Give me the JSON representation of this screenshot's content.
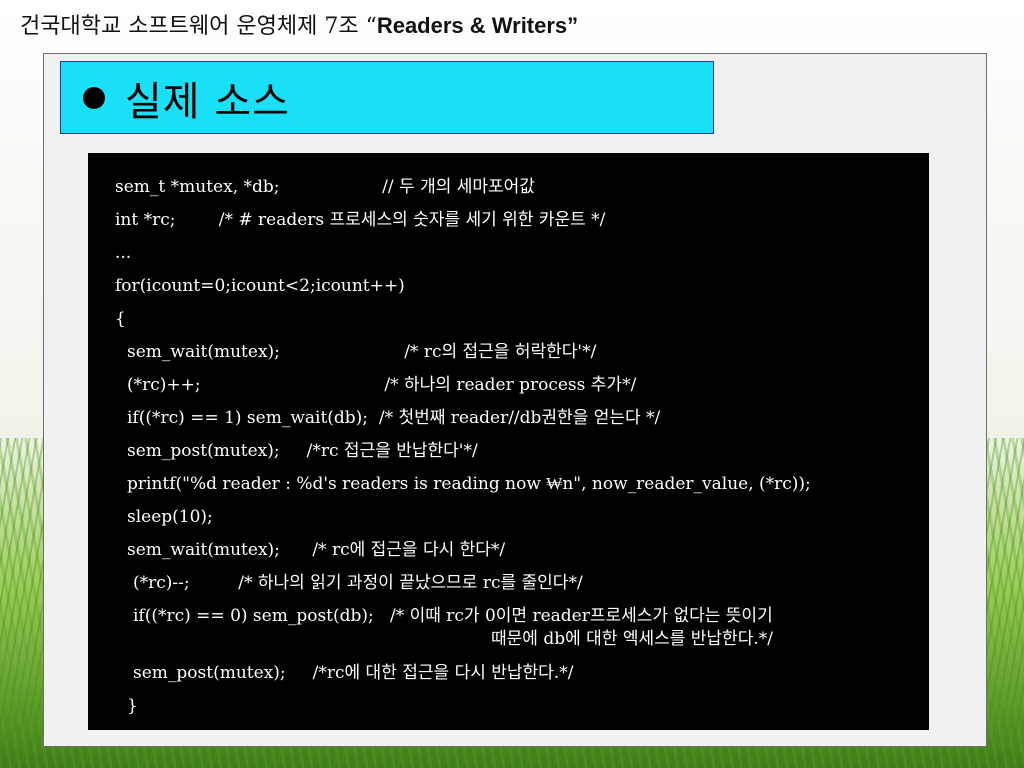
{
  "header": {
    "prefix": "건국대학교 소프트웨어 운영체제 7조 “",
    "title": "Readers & Writers”"
  },
  "slide": {
    "title": "실제 소스"
  },
  "code": {
    "lines": [
      "sem_t *mutex, *db;                   // 두 개의 세마포어값",
      "int *rc;        /* # readers 프로세스의 숫자를 세기 위한 카운트 */",
      "...",
      "for(icount=0;icount<2;icount++)",
      "{",
      "sem_wait(mutex);                       /* rc의 접근을 허락한다'*/",
      "(*rc)++;                                  /* 하나의 reader process 추가*/",
      "if((*rc) == 1) sem_wait(db);  /* 첫번째 reader//db권한을 얻는다 */",
      "sem_post(mutex);     /*rc 접근을 반납한다'*/",
      "printf(\"%d reader : %d's readers is reading now ₩n\", now_reader_value, (*rc));",
      "sleep(10);",
      "sem_wait(mutex);      /* rc에 접근을 다시 한다*/",
      "(*rc)--;         /* 하나의 읽기 과정이 끝났으므로 rc를 줄인다*/",
      "if((*rc) == 0) sem_post(db);   /* 이때 rc가 0이면 reader프로세스가 없다는 뜻이기",
      "때문에 db에 대한 엑세스를 반납한다.*/",
      "sem_post(mutex);     /*rc에 대한 접근을 다시 반납한다.*/",
      "}"
    ]
  }
}
